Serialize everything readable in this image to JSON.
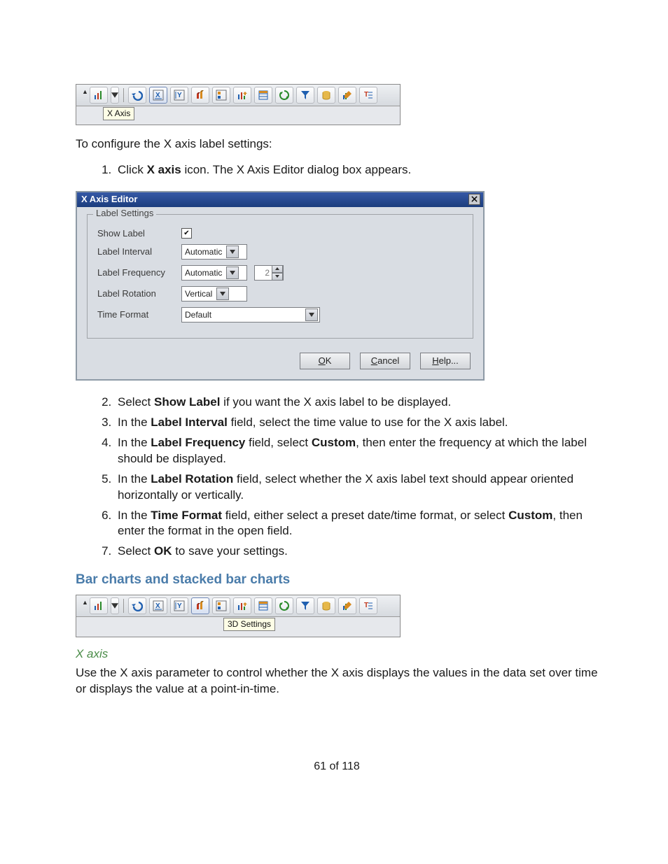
{
  "toolbar1": {
    "tooltip": "X Axis"
  },
  "intro_line": "To configure the X axis label settings:",
  "step1_pre": "Click ",
  "step1_bold": "X axis",
  "step1_post": " icon. The X Axis Editor dialog box appears.",
  "dialog": {
    "title": "X Axis Editor",
    "group": "Label Settings",
    "rows": {
      "show_label": "Show Label",
      "label_interval": "Label Interval",
      "label_frequency": "Label Frequency",
      "label_rotation": "Label Rotation",
      "time_format": "Time Format"
    },
    "values": {
      "interval": "Automatic",
      "frequency": "Automatic",
      "freq_num": "2",
      "rotation": "Vertical",
      "timefmt": "Default"
    },
    "buttons": {
      "ok": "OK",
      "cancel": "Cancel",
      "help": "Help..."
    },
    "ok_u": "O",
    "ok_rest": "K",
    "cancel_u": "C",
    "cancel_rest": "ancel",
    "help_u": "H",
    "help_rest": "elp..."
  },
  "step2_a": "Select ",
  "step2_b": "Show Label",
  "step2_c": " if you want the X axis label to be displayed.",
  "step3_a": "In the ",
  "step3_b": "Label Interval",
  "step3_c": " field, select the time value to use for the X axis label.",
  "step4_a": "In the ",
  "step4_b": "Label Frequency",
  "step4_c": " field, select ",
  "step4_d": "Custom",
  "step4_e": ", then enter the frequency at which the label should be displayed.",
  "step5_a": "In the ",
  "step5_b": "Label Rotation",
  "step5_c": " field, select whether the X axis label text should appear oriented horizontally or vertically.",
  "step6_a": "In the ",
  "step6_b": "Time Format",
  "step6_c": " field, either select a preset date/time format, or select ",
  "step6_d": "Custom",
  "step6_e": ", then enter the format in the open field.",
  "step7_a": "Select ",
  "step7_b": "OK",
  "step7_c": " to save your settings.",
  "heading_bars": "Bar charts and stacked bar charts",
  "toolbar2": {
    "tooltip": "3D Settings"
  },
  "sub_xaxis": "X axis",
  "xaxis_para": "Use the X axis parameter to control whether the X axis displays the values in the data set over time or displays the value at a point-in-time.",
  "pagenum": "61 of 118"
}
